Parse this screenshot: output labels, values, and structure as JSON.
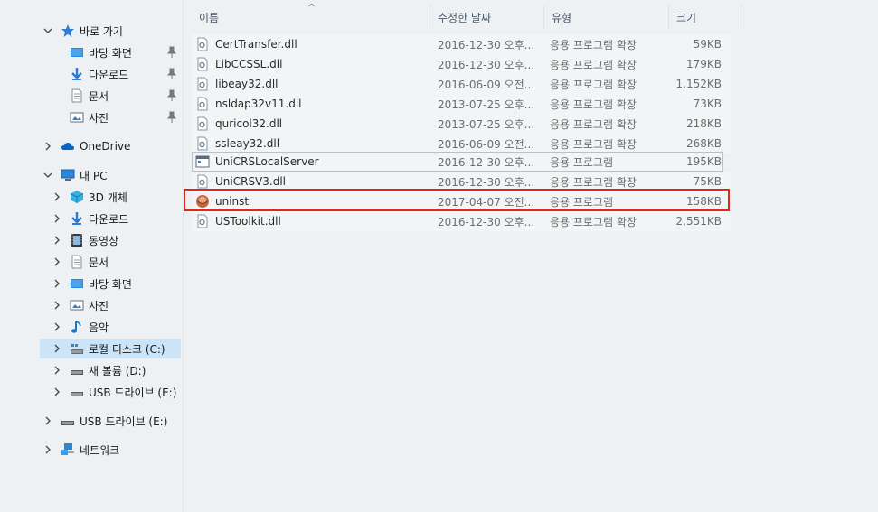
{
  "nav": {
    "quick_access": {
      "label": "바로 가기"
    },
    "quick_items": [
      {
        "label": "바탕 화면",
        "icon": "desktop-icon"
      },
      {
        "label": "다운로드",
        "icon": "download-icon"
      },
      {
        "label": "문서",
        "icon": "document-icon"
      },
      {
        "label": "사진",
        "icon": "pictures-icon"
      }
    ],
    "onedrive": {
      "label": "OneDrive"
    },
    "this_pc": {
      "label": "내 PC"
    },
    "pc_items": [
      {
        "label": "3D 개체",
        "icon": "3d-objects-icon"
      },
      {
        "label": "다운로드",
        "icon": "download-icon"
      },
      {
        "label": "동영상",
        "icon": "video-icon"
      },
      {
        "label": "문서",
        "icon": "document-icon"
      },
      {
        "label": "바탕 화면",
        "icon": "desktop-icon"
      },
      {
        "label": "사진",
        "icon": "pictures-icon"
      },
      {
        "label": "음악",
        "icon": "music-icon"
      },
      {
        "label": "로컬 디스크 (C:)",
        "icon": "local-disk-icon",
        "selected": true
      },
      {
        "label": "새 볼륨 (D:)",
        "icon": "drive-icon"
      },
      {
        "label": "USB 드라이브 (E:)",
        "icon": "usb-drive-icon"
      }
    ],
    "usb": {
      "label": "USB 드라이브 (E:)"
    },
    "network": {
      "label": "네트워크"
    }
  },
  "columns": {
    "name": "이름",
    "date": "수정한 날짜",
    "type": "유형",
    "size": "크기"
  },
  "files": [
    {
      "name": "CertTransfer.dll",
      "date": "2016-12-30 오후...",
      "type": "응용 프로그램 확장",
      "size": "59KB",
      "icon": "dll-file-icon"
    },
    {
      "name": "LibCCSSL.dll",
      "date": "2016-12-30 오후...",
      "type": "응용 프로그램 확장",
      "size": "179KB",
      "icon": "dll-file-icon"
    },
    {
      "name": "libeay32.dll",
      "date": "2016-06-09 오전...",
      "type": "응용 프로그램 확장",
      "size": "1,152KB",
      "icon": "dll-file-icon"
    },
    {
      "name": "nsldap32v11.dll",
      "date": "2013-07-25 오후...",
      "type": "응용 프로그램 확장",
      "size": "73KB",
      "icon": "dll-file-icon"
    },
    {
      "name": "quricol32.dll",
      "date": "2013-07-25 오후...",
      "type": "응용 프로그램 확장",
      "size": "218KB",
      "icon": "dll-file-icon"
    },
    {
      "name": "ssleay32.dll",
      "date": "2016-06-09 오전...",
      "type": "응용 프로그램 확장",
      "size": "268KB",
      "icon": "dll-file-icon"
    },
    {
      "name": "UniCRSLocalServer",
      "date": "2016-12-30 오후...",
      "type": "응용 프로그램",
      "size": "195KB",
      "icon": "exe-file-icon"
    },
    {
      "name": "UniCRSV3.dll",
      "date": "2016-12-30 오후...",
      "type": "응용 프로그램 확장",
      "size": "75KB",
      "icon": "dll-file-icon"
    },
    {
      "name": "uninst",
      "date": "2017-04-07 오전...",
      "type": "응용 프로그램",
      "size": "158KB",
      "icon": "uninstall-app-icon"
    },
    {
      "name": "USToolkit.dll",
      "date": "2016-12-30 오후...",
      "type": "응용 프로그램 확장",
      "size": "2,551KB",
      "icon": "dll-file-icon"
    }
  ],
  "colors": {
    "highlight": "#e0261f",
    "selected_bg": "#cce4f7"
  }
}
